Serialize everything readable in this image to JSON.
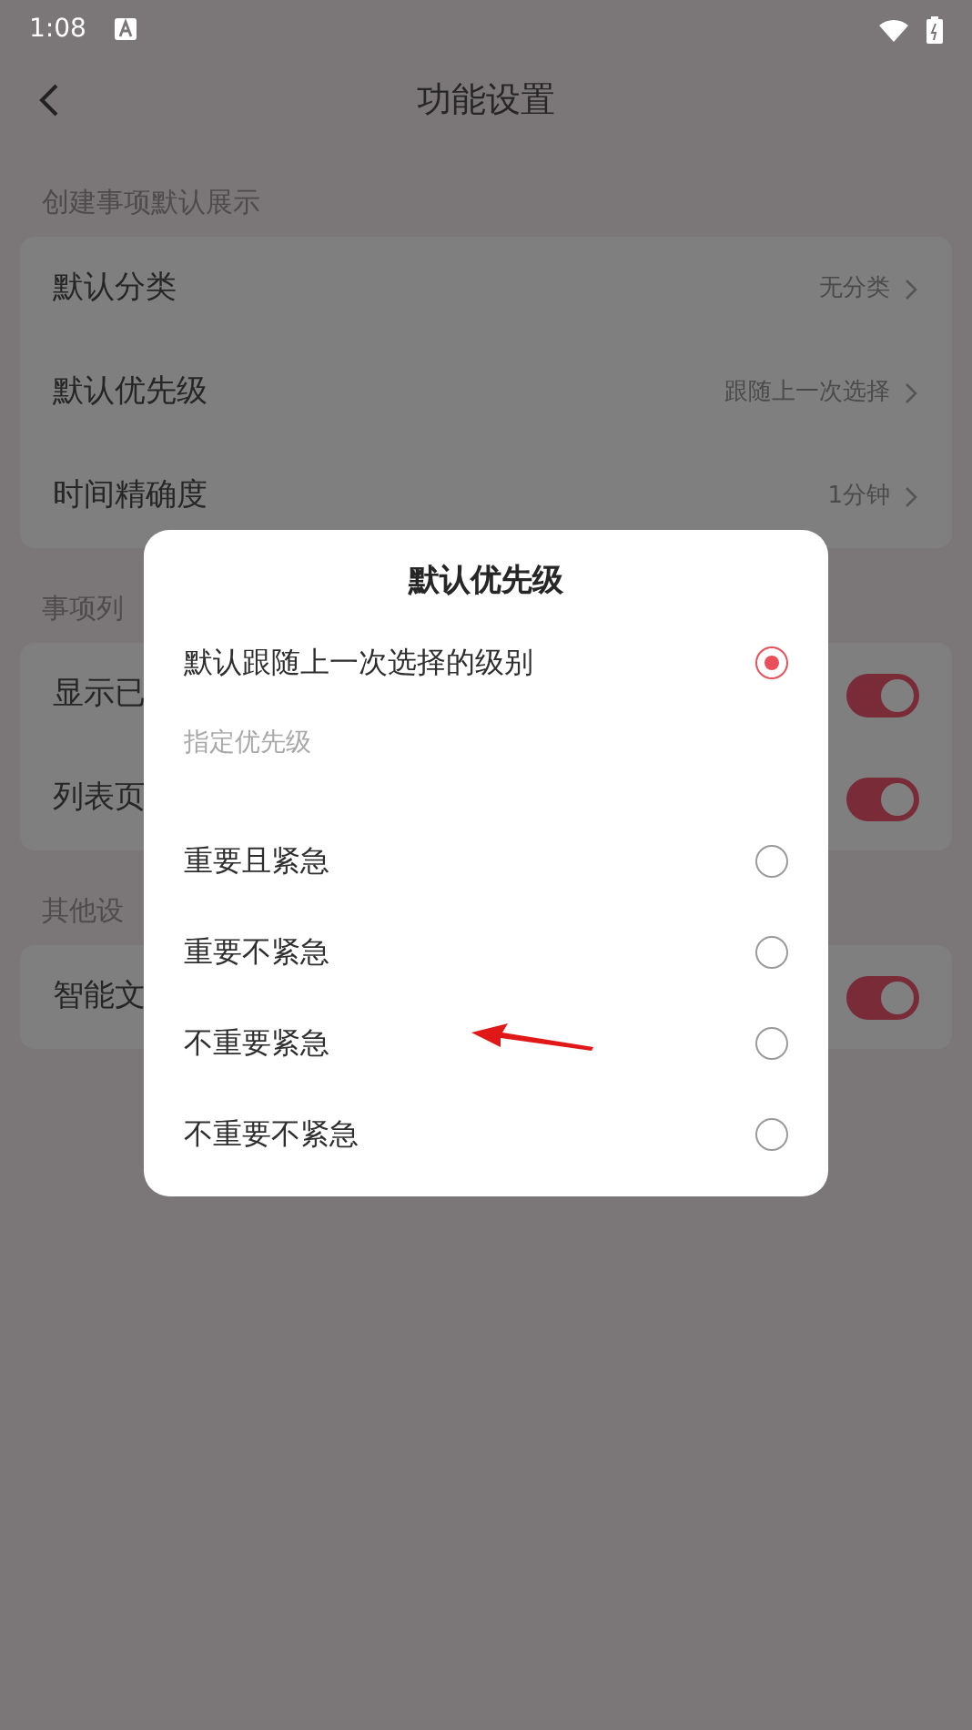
{
  "status_bar": {
    "time": "1:08"
  },
  "header": {
    "title": "功能设置"
  },
  "sections": [
    {
      "title": "创建事项默认展示",
      "rows": [
        {
          "kind": "link",
          "label": "默认分类",
          "value": "无分类"
        },
        {
          "kind": "link",
          "label": "默认优先级",
          "value": "跟随上一次选择"
        },
        {
          "kind": "link",
          "label": "时间精确度",
          "value": "1分钟"
        }
      ]
    },
    {
      "title": "事项列",
      "rows": [
        {
          "kind": "toggle",
          "label": "显示已",
          "on": true
        },
        {
          "kind": "toggle",
          "label": "列表页",
          "on": true
        }
      ]
    },
    {
      "title": "其他设",
      "rows": [
        {
          "kind": "toggle",
          "label": "智能文",
          "on": true
        }
      ]
    }
  ],
  "dialog": {
    "title": "默认优先级",
    "options": [
      {
        "kind": "option",
        "label": "默认跟随上一次选择的级别",
        "selected": true
      },
      {
        "kind": "heading",
        "label": "指定优先级"
      },
      {
        "kind": "option",
        "label": "重要且紧急",
        "selected": false
      },
      {
        "kind": "option",
        "label": "重要不紧急",
        "selected": false
      },
      {
        "kind": "option",
        "label": "不重要紧急",
        "selected": false
      },
      {
        "kind": "option",
        "label": "不重要不紧急",
        "selected": false
      }
    ]
  }
}
